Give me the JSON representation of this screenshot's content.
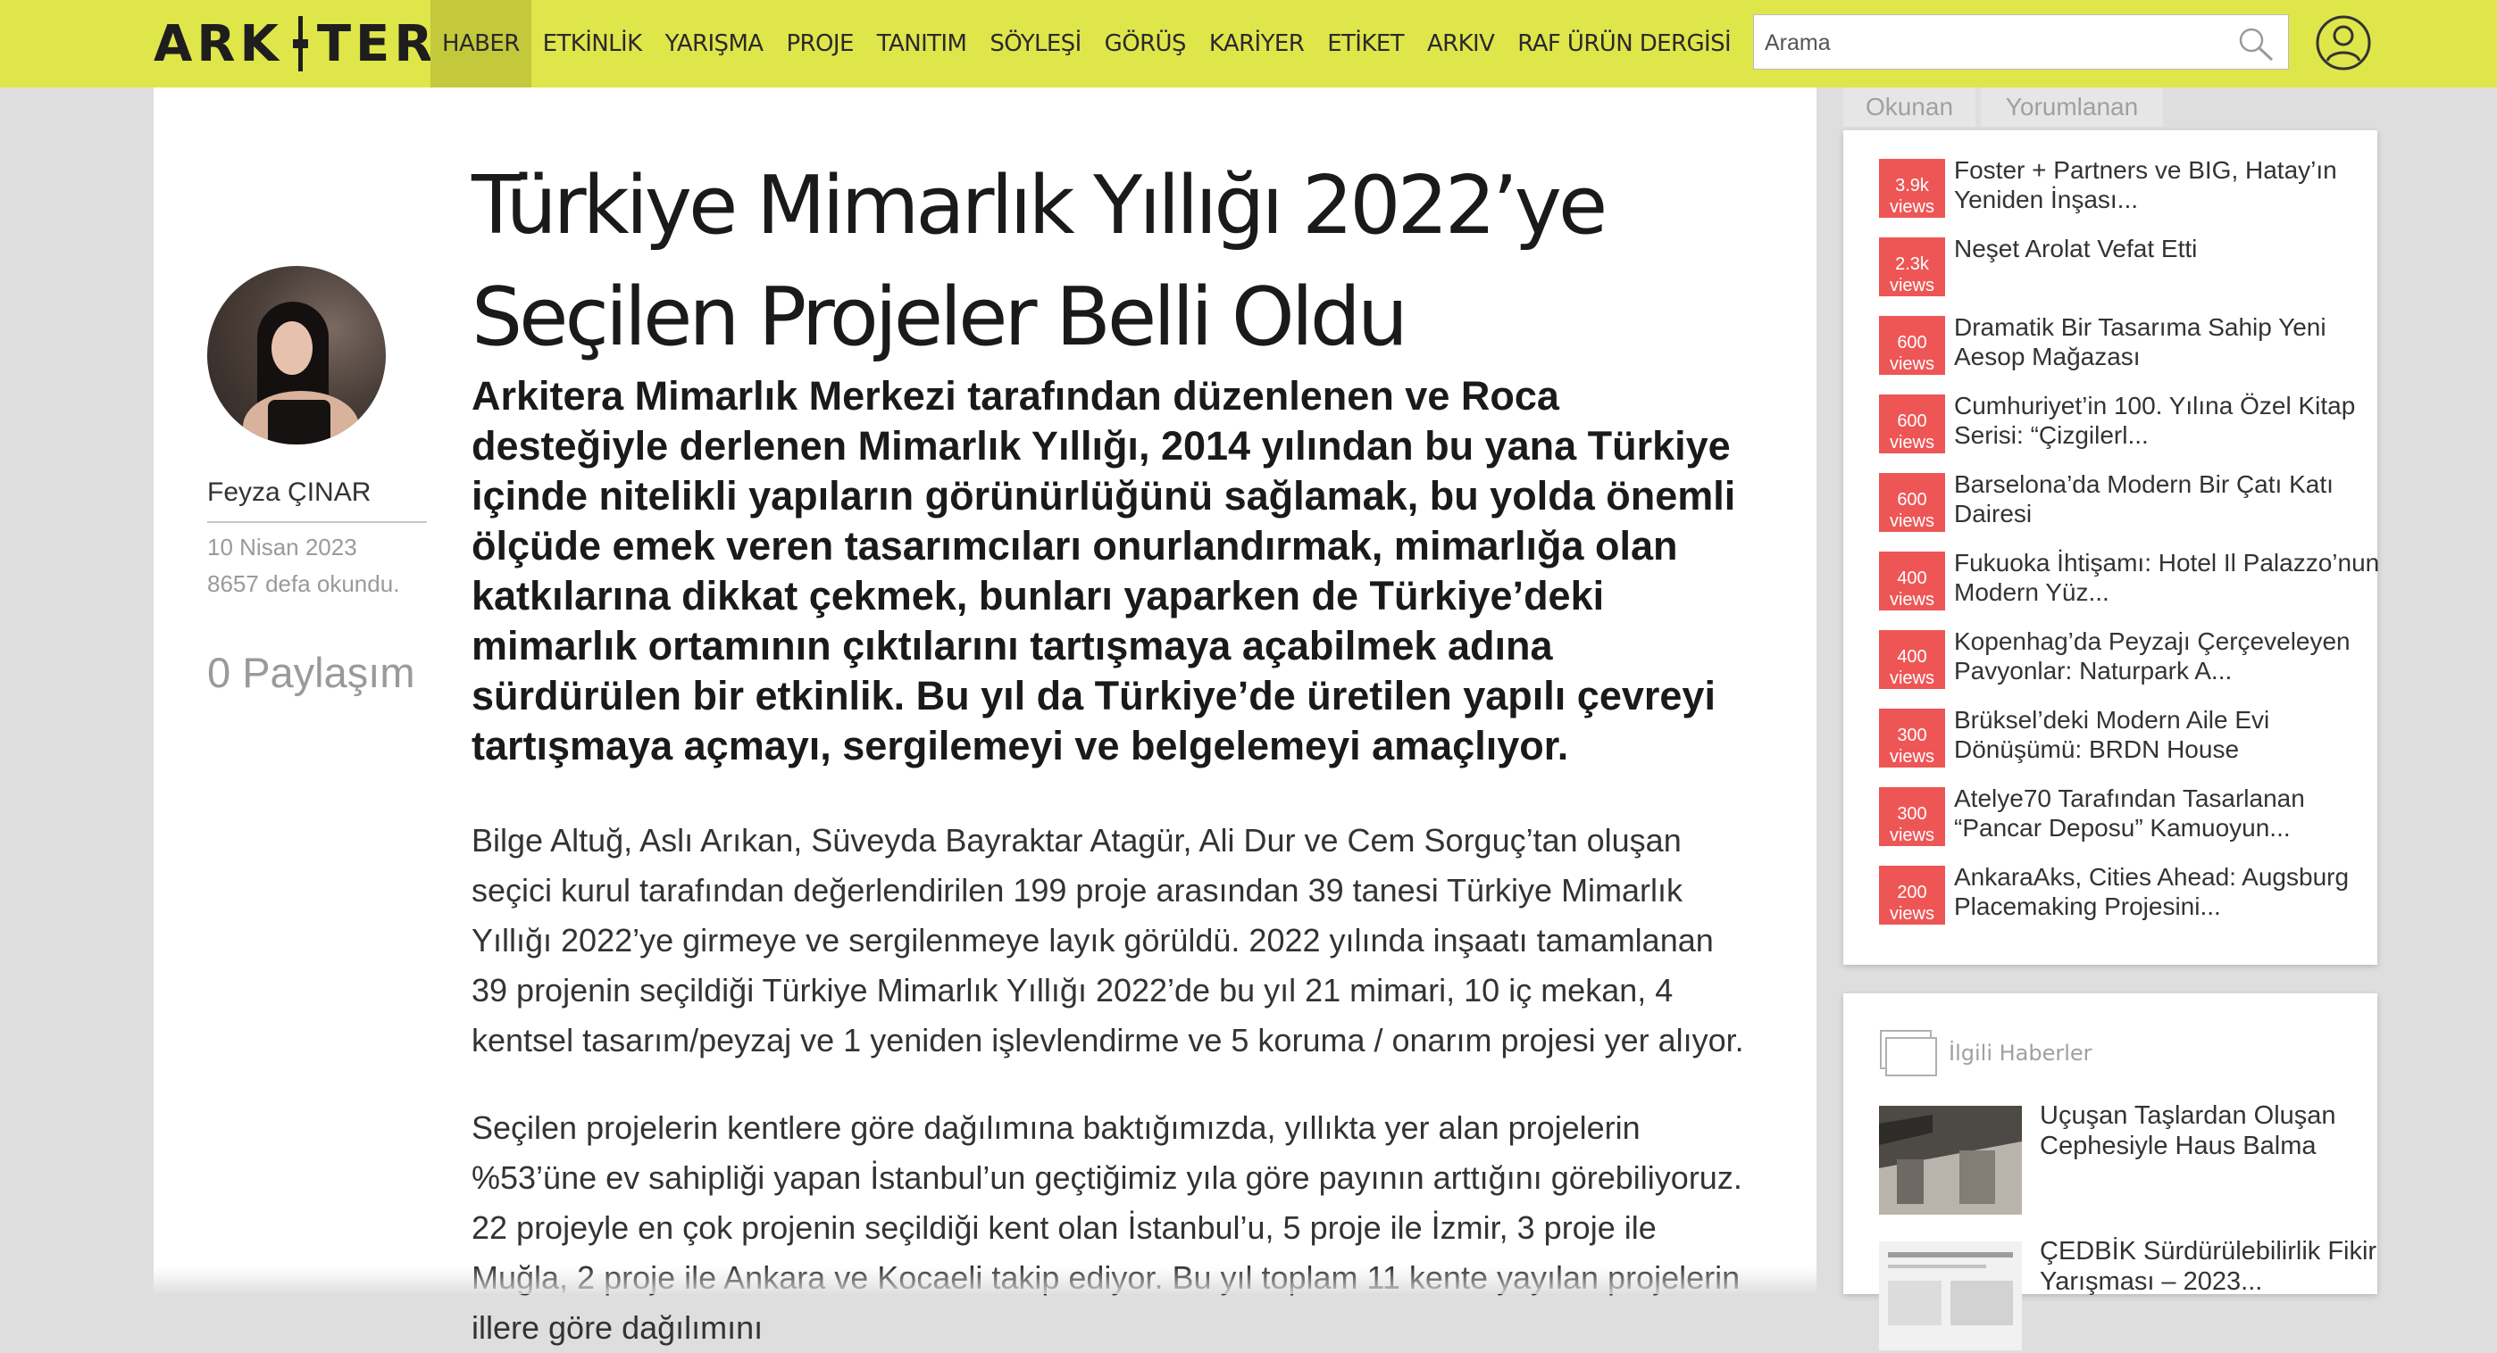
{
  "header": {
    "logo_left": "ARK",
    "logo_right": "TERA",
    "nav": [
      "HABER",
      "ETKİNLİK",
      "YARIŞMA",
      "PROJE",
      "TANITIM",
      "SÖYLEŞİ",
      "GÖRÜŞ",
      "KARİYER",
      "ETİKET",
      "ARKIV",
      "RAF ÜRÜN DERGİSİ"
    ],
    "active_nav": "HABER",
    "search_placeholder": "Arama",
    "icons": {
      "search": "search-icon",
      "user": "user-icon"
    }
  },
  "article": {
    "title": "Türkiye Mimarlık Yıllığı 2022’ye Seçilen Projeler Belli Oldu",
    "lead": "Arkitera Mimarlık Merkezi tarafından düzenlenen ve Roca desteğiyle derlenen Mimarlık Yıllığı, 2014 yılından bu yana Türkiye içinde nitelikli yapıların görünürlüğünü sağlamak, bu yolda önemli ölçüde emek veren tasarımcıları onurlandırmak, mimarlığa olan katkılarına dikkat çekmek, bunları yaparken de Türkiye’deki mimarlık ortamının çıktılarını tartışmaya açabilmek adına sürdürülen bir etkinlik. Bu yıl da Türkiye’de üretilen yapılı çevreyi tartışmaya açmayı, sergilemeyi ve belgelemeyi amaçlıyor.",
    "paragraphs": [
      "Bilge Altuğ, Aslı Arıkan, Süveyda Bayraktar Atagür, Ali Dur ve Cem Sorguç’tan oluşan seçici kurul tarafından değerlendirilen 199 proje arasından 39 tanesi Türkiye Mimarlık Yıllığı 2022’ye girmeye ve sergilenmeye layık görüldü. 2022 yılında inşaatı tamamlanan 39 projenin seçildiği Türkiye Mimarlık Yıllığı 2022’de bu yıl 21 mimari, 10 iç mekan, 4 kentsel tasarım/peyzaj ve 1 yeniden işlevlendirme ve 5 koruma / onarım projesi yer alıyor.",
      "Seçilen projelerin kentlere göre dağılımına baktığımızda, yıllıkta yer alan projelerin %53’üne ev sahipliği yapan İstanbul’un geçtiğimiz yıla göre payının arttığını görebiliyoruz. 22 projeyle en çok projenin seçildiği kent olan İstanbul’u, 5 proje ile İzmir, 3 proje ile Muğla, 2 proje ile Ankara ve Kocaeli takip ediyor. Bu yıl toplam 11 kente yayılan projelerin illere göre dağılımını"
    ],
    "author": "Feyza ÇINAR",
    "date": "10 Nisan 2023",
    "reads": "8657 defa okundu.",
    "shares": "0 Paylaşım"
  },
  "sidebar": {
    "tabs": [
      "Okunan",
      "Yorumlanan"
    ],
    "popular": [
      {
        "views": "3.9k",
        "unit": "views",
        "title": "Foster + Partners ve BIG, Hatay’ın Yeniden İnşası..."
      },
      {
        "views": "2.3k",
        "unit": "views",
        "title": "Neşet Arolat Vefat Etti"
      },
      {
        "views": "600",
        "unit": "views",
        "title": "Dramatik Bir Tasarıma Sahip Yeni Aesop Mağazası"
      },
      {
        "views": "600",
        "unit": "views",
        "title": "Cumhuriyet’in 100. Yılına Özel Kitap Serisi: “Çizgilerl..."
      },
      {
        "views": "600",
        "unit": "views",
        "title": "Barselona’da Modern Bir Çatı Katı Dairesi"
      },
      {
        "views": "400",
        "unit": "views",
        "title": "Fukuoka İhtişamı: Hotel Il Palazzo’nun Modern Yüz..."
      },
      {
        "views": "400",
        "unit": "views",
        "title": "Kopenhag’da Peyzajı Çerçeveleyen Pavyonlar: Naturpark A..."
      },
      {
        "views": "300",
        "unit": "views",
        "title": "Brüksel’deki Modern Aile Evi Dönüşümü: BRDN House"
      },
      {
        "views": "300",
        "unit": "views",
        "title": "Atelye70 Tarafından Tasarlanan “Pancar Deposu” Kamuoyun..."
      },
      {
        "views": "200",
        "unit": "views",
        "title": "AnkaraAks, Cities Ahead: Augsburg Placemaking Projesini..."
      }
    ],
    "related_header": "İlgili Haberler",
    "related": [
      {
        "title": "Uçuşan Taşlardan Oluşan Cephesiyle Haus Balma"
      },
      {
        "title": "ÇEDBİK Sürdürülebilirlik Fikir Yarışması – 2023..."
      }
    ],
    "colors": {
      "header_bg": "#dfe64a",
      "active_nav_bg": "#c4c93c",
      "badge": "#ee5656"
    }
  }
}
